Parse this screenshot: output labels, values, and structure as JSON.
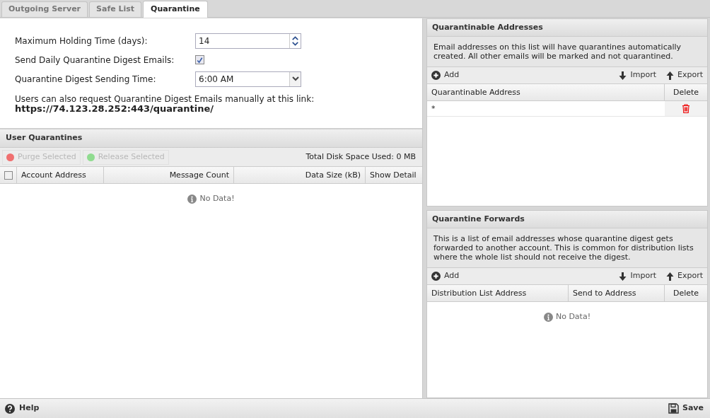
{
  "tabs": [
    {
      "label": "Outgoing Server",
      "selected": false
    },
    {
      "label": "Safe List",
      "selected": false
    },
    {
      "label": "Quarantine",
      "selected": true
    }
  ],
  "settings": {
    "holding_time": {
      "label": "Maximum Holding Time (days):",
      "value": "14"
    },
    "digest_emails": {
      "label": "Send Daily Quarantine Digest Emails:",
      "checked": true
    },
    "sending_time": {
      "label": "Quarantine Digest Sending Time:",
      "value": "6:00 AM"
    },
    "link_note": {
      "text": "Users can also request Quarantine Digest Emails manually at this link:",
      "url": "https://74.123.28.252:443/quarantine/"
    }
  },
  "user_quarantines": {
    "title": "User Quarantines",
    "actions": [
      {
        "label": "Purge Selected",
        "disabled": true,
        "color": "#f07070"
      },
      {
        "label": "Release Selected",
        "disabled": true,
        "color": "#90dc90"
      }
    ],
    "disk_space": "Total Disk Space Used: 0 MB",
    "select_all_checked": false,
    "columns": [
      "Account Address",
      "Message Count",
      "Data Size (kB)",
      "Show Detail"
    ],
    "empty_message": "No Data!"
  },
  "quarantinable_addresses": {
    "title": "Quarantinable Addresses",
    "description": "Email addresses on this list will have quarantines automatically created. All other emails will be marked and not quarantined.",
    "toolbar": {
      "add": "Add",
      "import": "Import",
      "export": "Export"
    },
    "columns": [
      "Quarantinable Address",
      "Delete"
    ],
    "rows": [
      {
        "address": "*"
      }
    ]
  },
  "quarantine_forwards": {
    "title": "Quarantine Forwards",
    "description": "This is a list of email addresses whose quarantine digest gets forwarded to another account. This is common for distribution lists where the whole list should not receive the digest.",
    "toolbar": {
      "add": "Add",
      "import": "Import",
      "export": "Export"
    },
    "columns": [
      "Distribution List Address",
      "Send to Address",
      "Delete"
    ],
    "empty_message": "No Data!"
  },
  "footer": {
    "help": "Help",
    "save": "Save"
  }
}
